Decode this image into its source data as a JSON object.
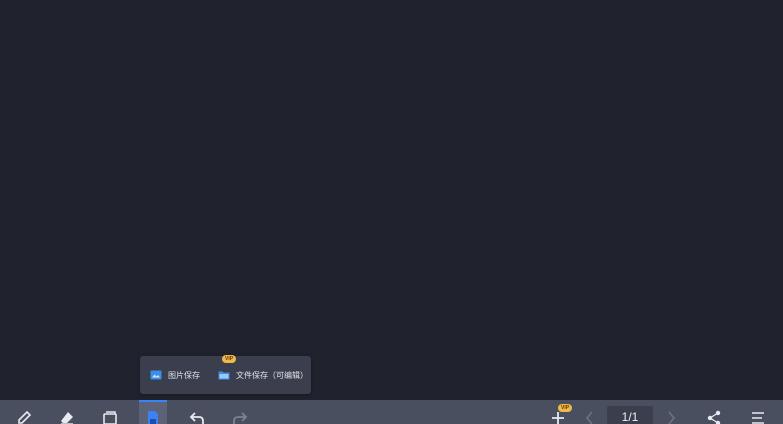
{
  "popup": {
    "image_save_label": "图片保存",
    "file_save_label": "文件保存（可编辑）",
    "vip_badge": "VIP"
  },
  "toolbar": {
    "page_indicator": "1/1",
    "add_page_vip_badge": "VIP",
    "icons": [
      "pen-icon",
      "eraser-icon",
      "clear-icon",
      "save-icon",
      "undo-icon",
      "redo-icon",
      "add-page-icon",
      "prev-page-icon",
      "next-page-icon",
      "share-icon",
      "menu-icon"
    ]
  },
  "colors": {
    "canvas": "#20232e",
    "toolbar": "#4a4f60",
    "accent": "#3b82f6",
    "vip": "#f0b84a"
  }
}
